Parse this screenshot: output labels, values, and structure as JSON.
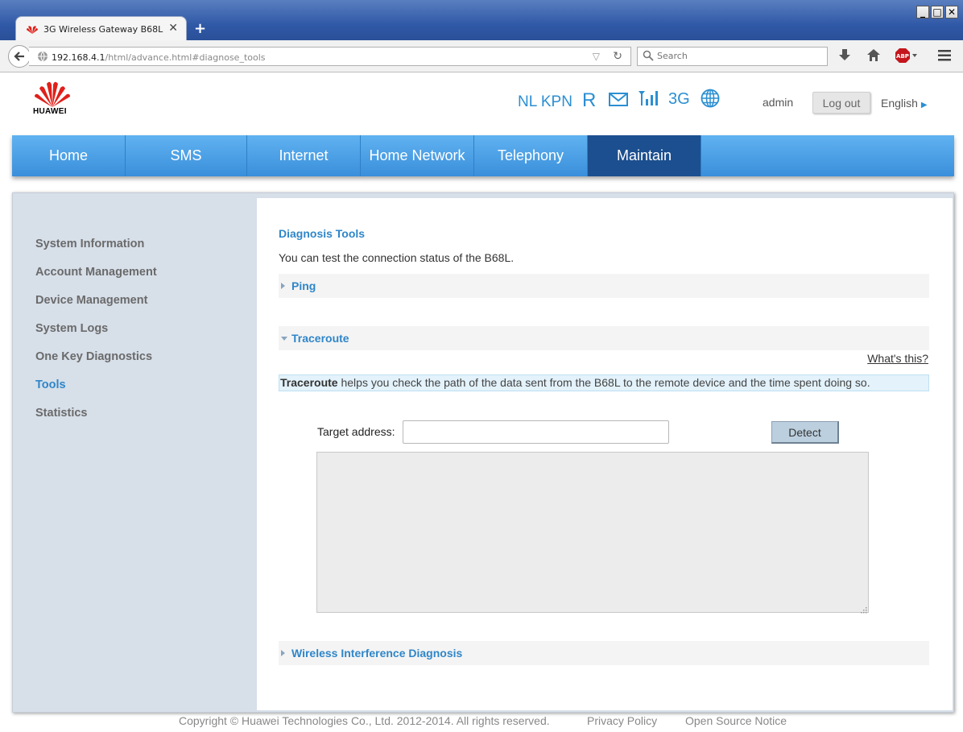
{
  "browser": {
    "tab_title": "3G Wireless Gateway B68L",
    "tab_close": "✕",
    "new_tab": "+",
    "url_host": "192.168.4.1",
    "url_path": "/html/advance.html#diagnose_tools",
    "search_placeholder": "Search",
    "window_buttons": [
      "_",
      "□",
      "✕"
    ],
    "adblock_label": "ABP"
  },
  "header": {
    "logo_text": "HUAWEI",
    "operator": "NL KPN",
    "roaming": "R",
    "network_type": "3G",
    "username": "admin",
    "logout_label": "Log out",
    "language": "English"
  },
  "nav": {
    "items": [
      "Home",
      "SMS",
      "Internet",
      "Home Network",
      "Telephony",
      "Maintain"
    ],
    "active": "Maintain"
  },
  "sidebar": {
    "items": [
      "System Information",
      "Account Management",
      "Device Management",
      "System Logs",
      "One Key Diagnostics",
      "Tools",
      "Statistics"
    ],
    "active": "Tools"
  },
  "main": {
    "title": "Diagnosis Tools",
    "description": "You can test the connection status of the B68L.",
    "sections": {
      "ping": "Ping",
      "traceroute": "Traceroute",
      "wireless": "Wireless Interference Diagnosis"
    },
    "whats_this": "What's this?",
    "info_bold": "Traceroute",
    "info_rest": " helps you check the path of the data sent from the B68L to the remote device and the time spent doing so.",
    "target_label": "Target address:",
    "target_value": "",
    "detect_label": "Detect",
    "result_text": ""
  },
  "footer": {
    "copyright": "Copyright © Huawei Technologies Co., Ltd. 2012-2014. All rights reserved.",
    "privacy": "Privacy Policy",
    "open_source": "Open Source Notice"
  },
  "colors": {
    "accent": "#2f86c9",
    "nav_active": "#1c4f8f",
    "nav_bg": "#4aa0e6",
    "sidebar_bg": "#d7dfe9"
  }
}
